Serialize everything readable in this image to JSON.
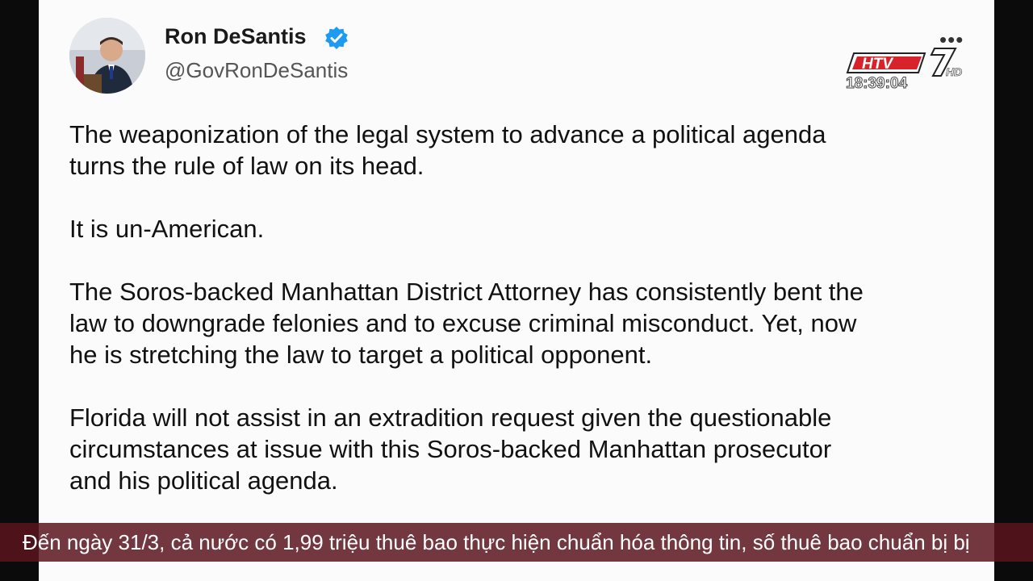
{
  "tweet": {
    "display_name": "Ron DeSantis",
    "handle": "@GovRonDeSantis",
    "more_label": "•••",
    "paragraphs": [
      "The weaponization of the legal system to advance a political agenda\nturns the rule of law on its head.",
      "It is un-American.",
      "The Soros-backed Manhattan District Attorney has consistently bent the\nlaw to downgrade felonies and to excuse criminal misconduct. Yet, now\nhe is stretching the law to target a political opponent.",
      "Florida will not assist in an extradition request given the questionable\ncircumstances at issue with this Soros-backed Manhattan prosecutor\nand his political agenda."
    ]
  },
  "broadcast": {
    "channel_logo": "HTV7 HD",
    "clock": "18:39:04",
    "ticker": "Đến ngày 31/3, cả nước có 1,99 triệu thuê bao thực hiện chuẩn hóa thông tin, số thuê bao chuẩn bị bị"
  },
  "colors": {
    "verified": "#1d9bf0",
    "ticker_bg": "#5a141e",
    "logo_red": "#d8232a"
  }
}
